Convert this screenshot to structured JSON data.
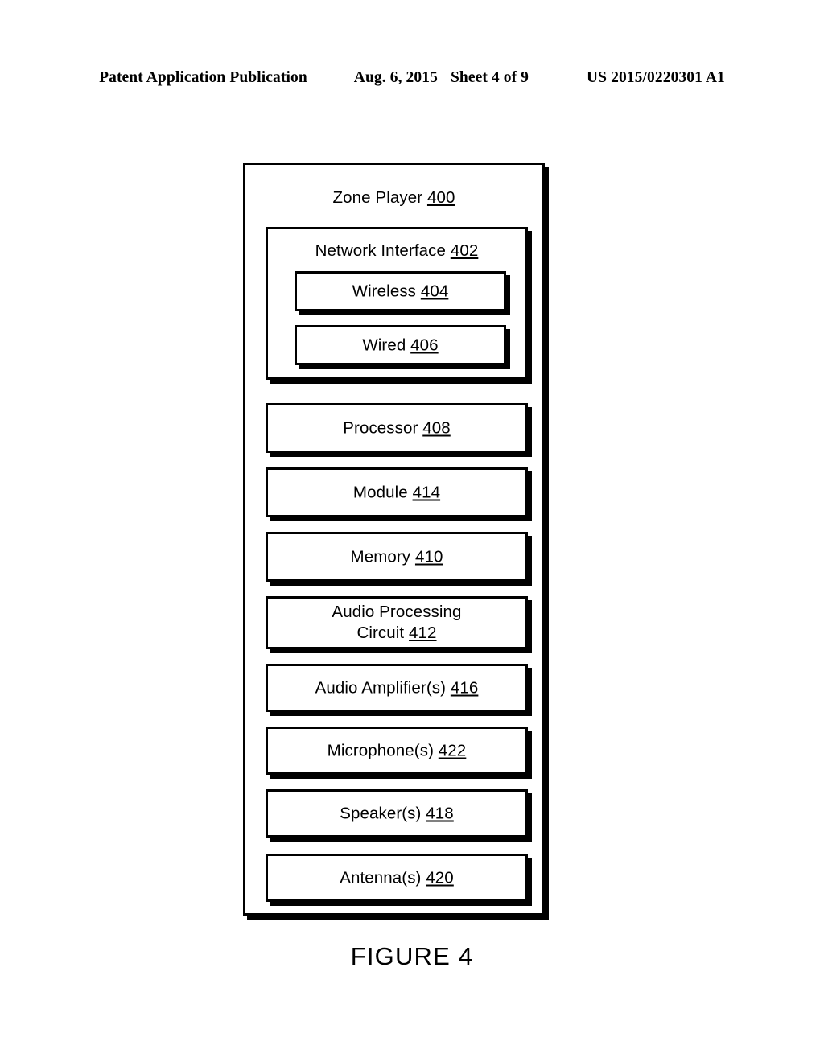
{
  "header": {
    "publication": "Patent Application Publication",
    "date": "Aug. 6, 2015",
    "sheet": "Sheet 4 of 9",
    "patent_number": "US 2015/0220301 A1"
  },
  "figure": {
    "caption": "FIGURE 4",
    "outer": {
      "title": "Zone Player",
      "ref": "400"
    },
    "network_interface": {
      "title": "Network Interface",
      "ref": "402",
      "children": [
        {
          "label": "Wireless",
          "ref": "404"
        },
        {
          "label": "Wired",
          "ref": "406"
        }
      ]
    },
    "components": [
      {
        "label": "Processor",
        "ref": "408"
      },
      {
        "label": "Module",
        "ref": "414"
      },
      {
        "label": "Memory",
        "ref": "410"
      },
      {
        "label": "Audio Processing",
        "label_line2": "Circuit",
        "ref": "412"
      },
      {
        "label": "Audio Amplifier(s)",
        "ref": "416"
      },
      {
        "label": "Microphone(s)",
        "ref": "422"
      },
      {
        "label": "Speaker(s)",
        "ref": "418"
      },
      {
        "label": "Antenna(s)",
        "ref": "420"
      }
    ]
  },
  "colors": {
    "ink": "#000000",
    "paper": "#ffffff"
  }
}
